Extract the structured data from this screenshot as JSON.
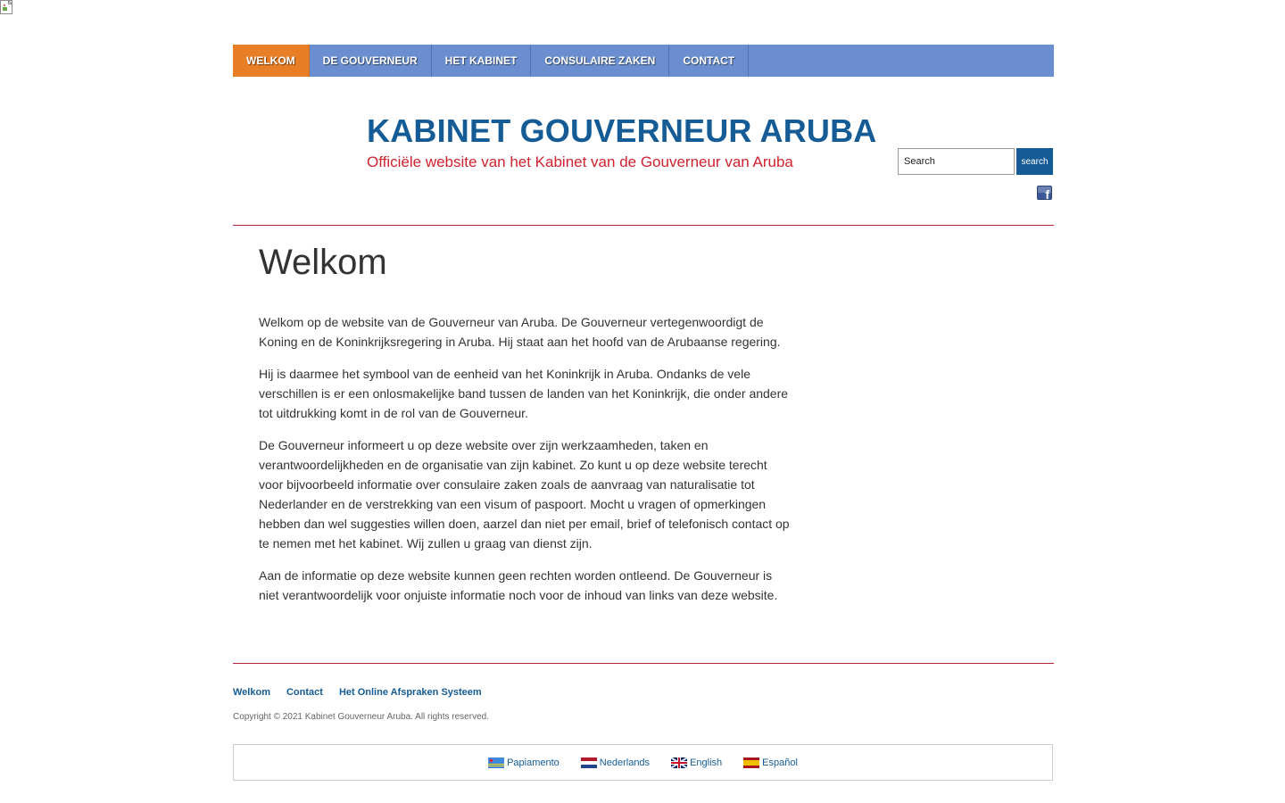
{
  "nav": {
    "items": [
      {
        "label": "WELKOM",
        "active": true
      },
      {
        "label": "DE GOUVERNEUR",
        "active": false
      },
      {
        "label": "HET KABINET",
        "active": false
      },
      {
        "label": "CONSULAIRE ZAKEN",
        "active": false
      },
      {
        "label": "CONTACT",
        "active": false
      }
    ],
    "bar_color": "#6a8ecf",
    "active_color": "#e87e26"
  },
  "header": {
    "title": "KABINET GOUVERNEUR ARUBA",
    "subtitle": "Officiële website van het Kabinet van de Gouverneur van Aruba",
    "title_color": "#155c96",
    "subtitle_color": "#d0222e"
  },
  "search": {
    "placeholder": "Search",
    "button_label": "search"
  },
  "social": {
    "icon": "facebook-icon"
  },
  "main": {
    "page_title": "Welkom",
    "paragraphs": [
      "Welkom op de website van de Gouverneur van Aruba. De Gouverneur vertegenwoordigt de Koning en de Koninkrijksregering in Aruba. Hij staat aan het hoofd van de Arubaanse regering.",
      "Hij is daarmee het symbool van de eenheid van het Koninkrijk in Aruba. Ondanks de vele verschillen is er een onlosmakelijke band tussen de landen van het Koninkrijk, die onder andere tot uitdrukking komt in de rol van de Gouverneur.",
      "De Gouverneur informeert u op deze website over zijn werkzaamheden, taken en verantwoordelijkheden en de organisatie van zijn kabinet. Zo kunt u op deze website terecht voor bijvoorbeeld informatie over consulaire zaken zoals de aanvraag van naturalisatie tot Nederlander en de verstrekking van een visum of paspoort. Mocht u vragen of opmerkingen hebben dan wel suggesties willen doen, aarzel dan niet per email, brief of telefonisch contact op te nemen met het kabinet. Wij zullen u graag van dienst zijn.",
      "Aan de informatie op deze website kunnen geen rechten worden ontleend. De Gouverneur is niet verantwoordelijk voor onjuiste informatie noch voor de inhoud van links van deze website."
    ]
  },
  "footer": {
    "links": [
      "Welkom",
      "Contact",
      "Het Online Afspraken Systeem"
    ],
    "copyright": "Copyright © 2021 Kabinet Gouverneur Aruba. All rights reserved."
  },
  "languages": [
    {
      "label": "Papiamento",
      "flag": "aruba-flag-icon"
    },
    {
      "label": "Nederlands",
      "flag": "netherlands-flag-icon"
    },
    {
      "label": "English",
      "flag": "uk-flag-icon"
    },
    {
      "label": "Español",
      "flag": "spain-flag-icon"
    }
  ]
}
